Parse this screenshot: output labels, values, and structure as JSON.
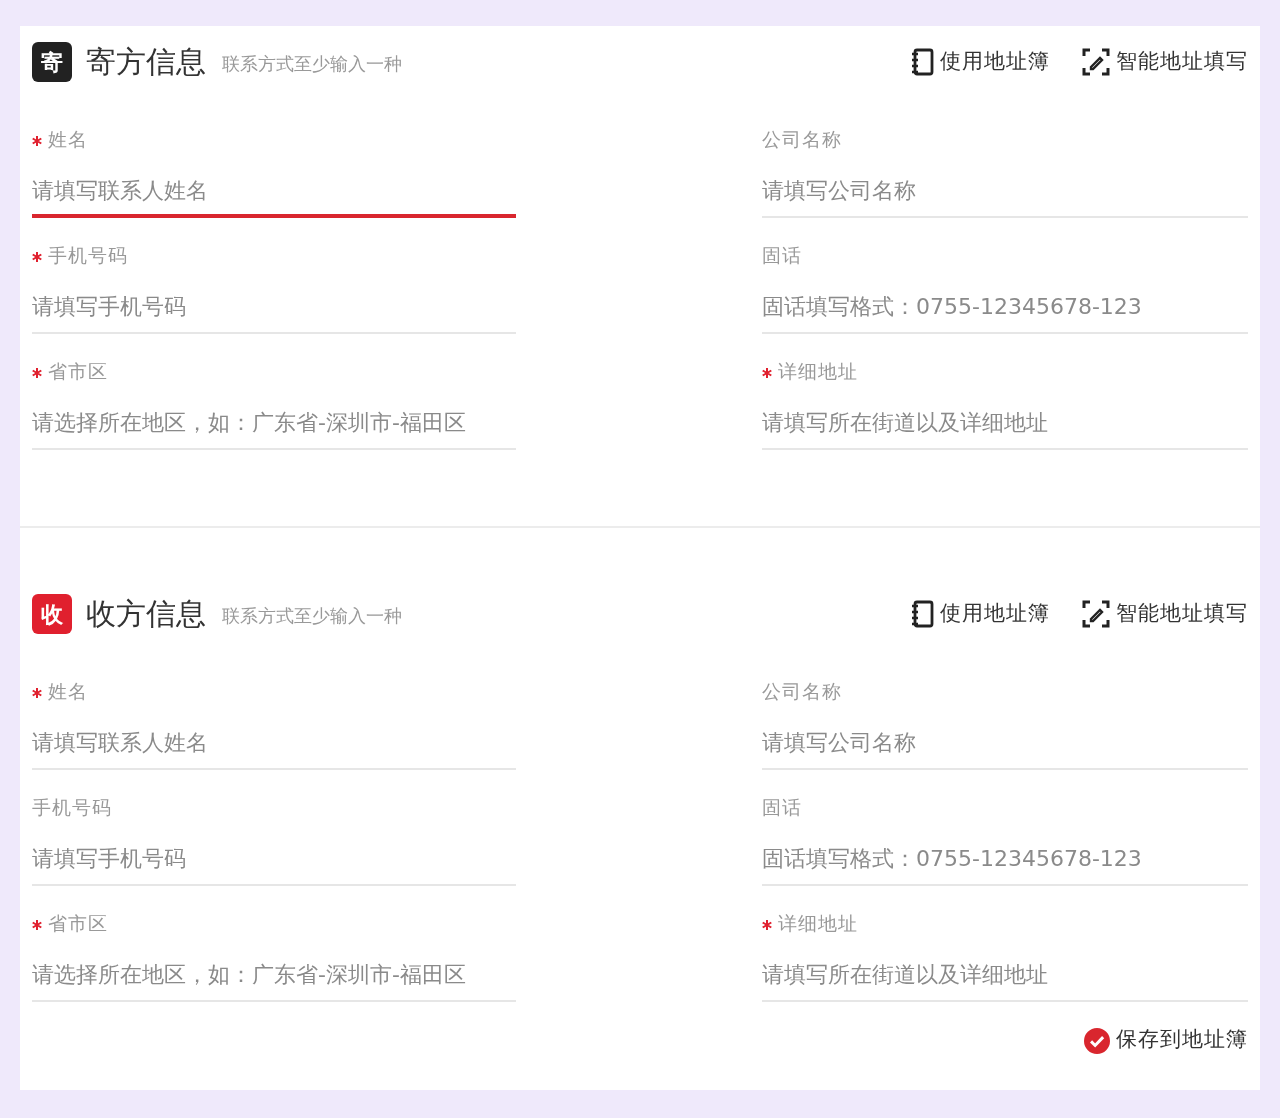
{
  "sections": [
    {
      "badge": "寄",
      "color": "#222222",
      "title": "寄方信息",
      "hint": "联系方式至少输入一种",
      "actions": [
        {
          "kind": "book",
          "label": "使用地址簿"
        },
        {
          "kind": "scan",
          "label": "智能地址填写"
        }
      ],
      "fields": [
        {
          "label": "姓名",
          "required": true,
          "placeholder": "请填写联系人姓名",
          "focused": true
        },
        {
          "label": "公司名称",
          "required": false,
          "placeholder": "请填写公司名称",
          "focused": false
        },
        {
          "label": "手机号码",
          "required": true,
          "placeholder": "请填写手机号码",
          "focused": false
        },
        {
          "label": "固话",
          "required": false,
          "placeholder": "固话填写格式：0755-12345678-123",
          "focused": false
        },
        {
          "label": "省市区",
          "required": true,
          "placeholder": "请选择所在地区，如：广东省-深圳市-福田区",
          "focused": false
        },
        {
          "label": "详细地址",
          "required": true,
          "placeholder": "请填写所在街道以及详细地址",
          "focused": false
        }
      ]
    },
    {
      "badge": "收",
      "color": "#e0202e",
      "title": "收方信息",
      "hint": "联系方式至少输入一种",
      "actions": [
        {
          "kind": "book",
          "label": "使用地址簿"
        },
        {
          "kind": "scan",
          "label": "智能地址填写"
        }
      ],
      "fields": [
        {
          "label": "姓名",
          "required": true,
          "placeholder": "请填写联系人姓名",
          "focused": false
        },
        {
          "label": "公司名称",
          "required": false,
          "placeholder": "请填写公司名称",
          "focused": false
        },
        {
          "label": "手机号码",
          "required": false,
          "placeholder": "请填写手机号码",
          "focused": false
        },
        {
          "label": "固话",
          "required": false,
          "placeholder": "固话填写格式：0755-12345678-123",
          "focused": false
        },
        {
          "label": "省市区",
          "required": true,
          "placeholder": "请选择所在地区，如：广东省-深圳市-福田区",
          "focused": false
        },
        {
          "label": "详细地址",
          "required": true,
          "placeholder": "请填写所在街道以及详细地址",
          "focused": false
        }
      ],
      "save": {
        "label": "保存到地址簿",
        "checked": true
      }
    }
  ]
}
